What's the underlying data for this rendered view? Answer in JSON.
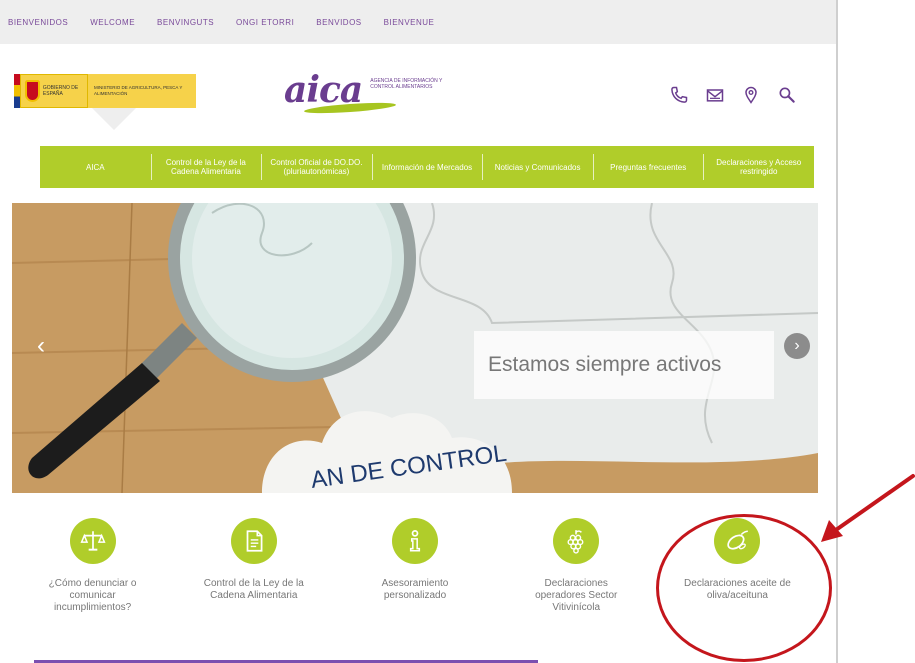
{
  "languages": [
    "BIENVENIDOS",
    "WELCOME",
    "BENVINGUTS",
    "ONGI ETORRI",
    "BENVIDOS",
    "BIENVENUE"
  ],
  "gov_logo": {
    "gob_text": "GOBIERNO DE ESPAÑA",
    "ministry_text": "MINISTERIO DE AGRICULTURA, PESCA Y ALIMENTACIÓN"
  },
  "brand": {
    "name": "aica",
    "subtitle": "AGENCIA DE INFORMACIÓN Y CONTROL ALIMENTARIOS",
    "purple": "#6a3d8f",
    "green": "#b0cd2a"
  },
  "header_icons": [
    "phone-icon",
    "mail-icon",
    "location-pin-icon",
    "search-icon"
  ],
  "nav": [
    "AICA",
    "Control de la Ley de la Cadena Alimentaria",
    "Control Oficial de DO.DO. (pluriautonómicas)",
    "Información de Mercados",
    "Noticias y Comunicados",
    "Preguntas frecuentes",
    "Declaraciones y Acceso restringido"
  ],
  "hero": {
    "caption": "Estamos siempre activos",
    "puzzle_text": "AN DE CONTROL",
    "prev": "‹",
    "next": "›"
  },
  "features": [
    {
      "label": "¿Cómo denunciar o comunicar incumplimientos?",
      "icon": "scales-icon"
    },
    {
      "label": "Control de la Ley de la Cadena Alimentaria",
      "icon": "document-icon"
    },
    {
      "label": "Asesoramiento personalizado",
      "icon": "info-icon"
    },
    {
      "label": "Declaraciones operadores Sector Vitivinícola",
      "icon": "grapes-icon"
    },
    {
      "label": "Declaraciones aceite de oliva/aceituna",
      "icon": "olive-icon"
    }
  ],
  "annotation_color": "#c4161c"
}
